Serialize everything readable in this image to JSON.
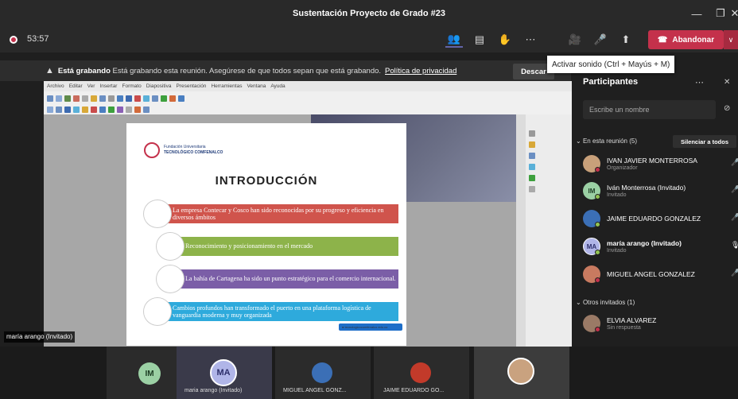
{
  "window": {
    "title": "Sustentación Proyecto de Grado #23",
    "min": "—",
    "max": "❐",
    "close": "✕"
  },
  "meeting": {
    "timer": "53:57",
    "leave_label": "Abandonar",
    "leave_drop": "∨",
    "tooltip": "Activar sonido (Ctrl + Mayús + M)"
  },
  "toolbar_icons": {
    "people": "👥",
    "chat": "▤",
    "raise": "✋",
    "more": "⋯",
    "camera": "🎥",
    "mic": "🎤",
    "share": "⬆"
  },
  "banner": {
    "strong": "Está grabando",
    "text": "Está grabando esta reunión. Asegúrese de que todos sepan que está grabando.",
    "link": "Política de privacidad",
    "dismiss": "Descar"
  },
  "share": {
    "menu": [
      "Archivo",
      "Editar",
      "Ver",
      "Insertar",
      "Formato",
      "Diapositiva",
      "Presentación",
      "Herramientas",
      "Ventana",
      "Ayuda"
    ],
    "slide": {
      "logo_line1": "Fundación Universitaria",
      "logo_line2": "TECNOLÓGICO COMFENALCO",
      "title": "INTRODUCCIÓN",
      "items": [
        {
          "text": "La empresa Contecar y Cosco han sido reconocidas por su progreso y eficiencia en diversos ámbitos",
          "color": "#d0544c"
        },
        {
          "text": "Reconocimiento y posicionamiento en el mercado",
          "color": "#8db34a"
        },
        {
          "text": "La bahía de Cartagena ha sido un punto estratégico para el comercio internacional.",
          "color": "#7b5ea7"
        },
        {
          "text": "Cambios profundos han transformado el puerto en una plataforma logística de vanguardia moderna y muy organizada",
          "color": "#2eaadc"
        }
      ],
      "url": "● tecnologicocomfenalco.edu.co"
    }
  },
  "self_view_label": "maría arango (Invitado)",
  "stage": [
    {
      "initials": "IM",
      "name": "",
      "color": "#9bd0a4"
    },
    {
      "initials": "MA",
      "name": "maria arango (Invitado)",
      "color": "#b0b5e8"
    },
    {
      "initials": "",
      "name": "MIGUEL ANGEL GONZ...",
      "color": "#3b6fb6"
    },
    {
      "initials": "",
      "name": "JAIME EDUARDO GO...",
      "color": "#c23a2a"
    },
    {
      "initials": "",
      "name": "",
      "color": "#c9a27f"
    }
  ],
  "participants": {
    "title": "Participantes",
    "more": "⋯",
    "close": "✕",
    "search_placeholder": "Escribe un nombre",
    "in_meeting_label": "En esta reunión (5)",
    "mute_all": "Silenciar a todos",
    "others_label": "Otros invitados (1)",
    "list": [
      {
        "name": "IVAN JAVIER MONTERROSA",
        "role": "Organizador",
        "initials": "",
        "color": "#c8a07a"
      },
      {
        "name": "Iván Monterrosa (Invitado)",
        "role": "Invitado",
        "initials": "IM",
        "color": "#9bd0a4"
      },
      {
        "name": "JAIME EDUARDO GONZALEZ",
        "role": "",
        "initials": "",
        "color": "#3b6fb6"
      },
      {
        "name": "maría arango (Invitado)",
        "role": "Invitado",
        "initials": "MA",
        "color": "#b0b5e8"
      },
      {
        "name": "MIGUEL ANGEL GONZALEZ",
        "role": "",
        "initials": "",
        "color": "#c87a60"
      }
    ],
    "others": [
      {
        "name": "ELVIA ALVAREZ",
        "role": "Sin respuesta",
        "initials": "",
        "color": "#9a7a66"
      }
    ]
  }
}
